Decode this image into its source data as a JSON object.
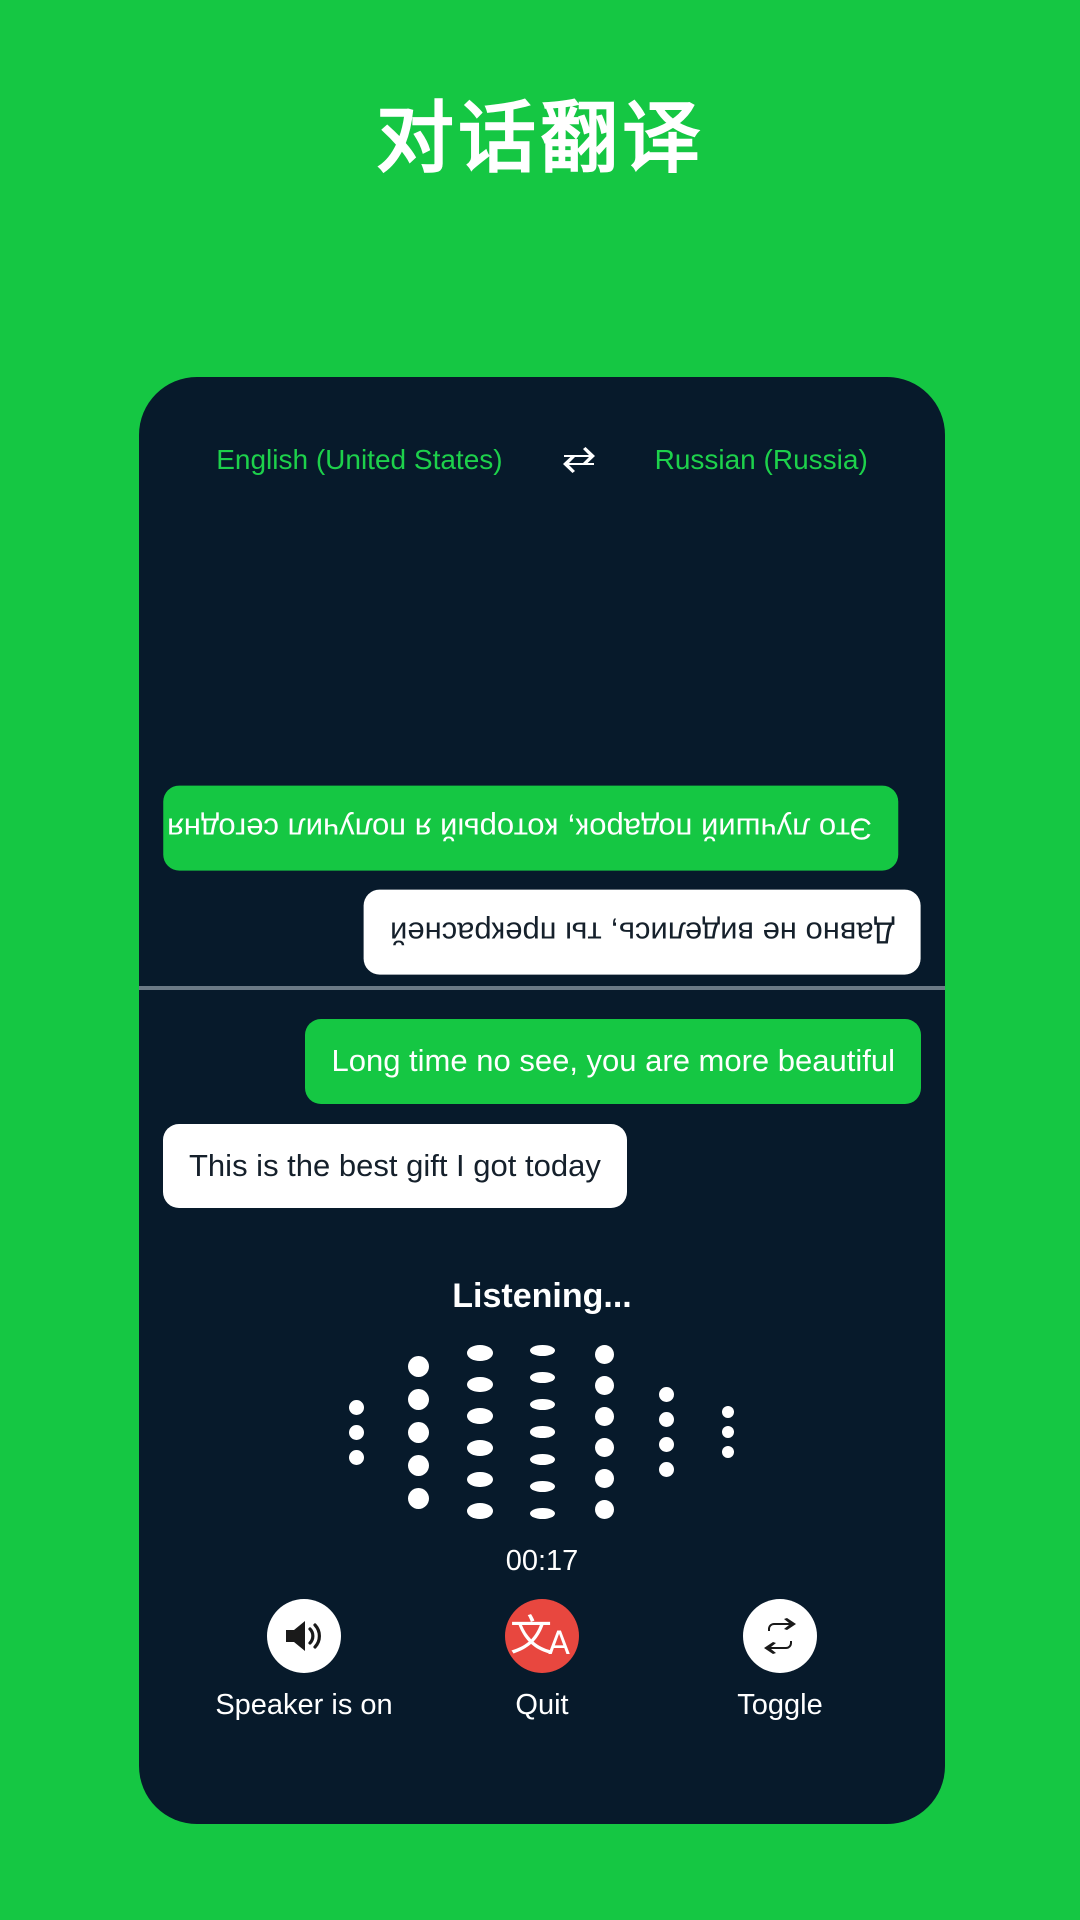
{
  "page": {
    "title": "对话翻译",
    "background_color": "#15C743",
    "card_color": "#071A2B"
  },
  "header": {
    "source_language": "English (United States)",
    "swap_icon": "swap-horizontal-arrows-icon",
    "target_language": "Russian (Russia)",
    "language_color": "#1DD14B"
  },
  "top_panel": {
    "orientation": "rotated-180",
    "messages": [
      {
        "text": "Это лучший подарок, который я получил сегодня",
        "style": "green",
        "align": "left"
      },
      {
        "text": "Давно не виделись, ты прекрасней",
        "style": "white",
        "align": "right"
      }
    ]
  },
  "bottom_panel": {
    "orientation": "normal",
    "messages": [
      {
        "text": "Long time no see, you are more beautiful",
        "style": "green",
        "align": "right"
      },
      {
        "text": "This is the best gift I got today",
        "style": "white",
        "align": "left"
      }
    ]
  },
  "status": {
    "listening_label": "Listening...",
    "timer": "00:17"
  },
  "waveform": {
    "columns": [
      {
        "dots": 3,
        "size": 15
      },
      {
        "dots": 5,
        "size": 21
      },
      {
        "dots": 6,
        "size": 26
      },
      {
        "dots": 7,
        "size": 25
      },
      {
        "dots": 6,
        "size": 19
      },
      {
        "dots": 4,
        "size": 15
      },
      {
        "dots": 3,
        "size": 12
      }
    ],
    "dot_color": "#ffffff"
  },
  "controls": [
    {
      "label": "Speaker is on",
      "icon": "speaker-on-icon",
      "circle_style": "white"
    },
    {
      "label": "Quit",
      "icon": "translate-icon",
      "circle_style": "red",
      "circle_color": "#E8473F"
    },
    {
      "label": "Toggle",
      "icon": "swap-repeat-icon",
      "circle_style": "white"
    }
  ]
}
